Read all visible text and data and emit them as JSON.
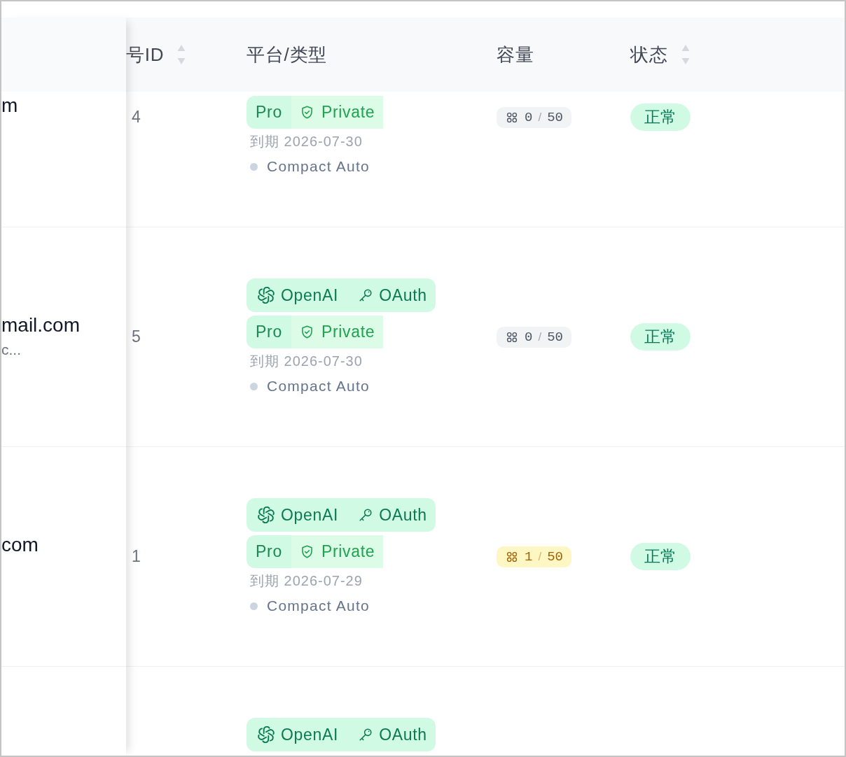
{
  "header": {
    "columns": [
      {
        "label": "号ID",
        "kind": "sortable"
      },
      {
        "label": "平台/类型",
        "kind": "plain"
      },
      {
        "label": "容量",
        "kind": "plain"
      },
      {
        "label": "状态",
        "kind": "sortable"
      }
    ]
  },
  "rows": [
    {
      "account": {
        "name": "m"
      },
      "id": "4",
      "plan": {
        "name": "Pro",
        "privacy": "Private"
      },
      "expiry": "到期 2026-07-30",
      "mode": "Compact Auto",
      "capacity": {
        "kind": "empty",
        "used": "0",
        "separator": "/",
        "total": "50"
      },
      "status": "正常"
    },
    {
      "account": {
        "name": "mail.com",
        "note": "c..."
      },
      "id": "5",
      "platform": {
        "name": "OpenAI",
        "auth": "OAuth"
      },
      "plan": {
        "name": "Pro",
        "privacy": "Private"
      },
      "expiry": "到期 2026-07-30",
      "mode": "Compact Auto",
      "capacity": {
        "kind": "empty",
        "used": "0",
        "separator": "/",
        "total": "50"
      },
      "status": "正常"
    },
    {
      "account": {
        "name": "com"
      },
      "id": "1",
      "platform": {
        "name": "OpenAI",
        "auth": "OAuth"
      },
      "plan": {
        "name": "Pro",
        "privacy": "Private"
      },
      "expiry": "到期 2026-07-29",
      "mode": "Compact Auto",
      "capacity": {
        "kind": "in_use",
        "used": "1",
        "separator": "/",
        "total": "50"
      },
      "status": "正常"
    },
    {
      "platform": {
        "name": "OpenAI",
        "auth": "OAuth"
      }
    }
  ]
}
